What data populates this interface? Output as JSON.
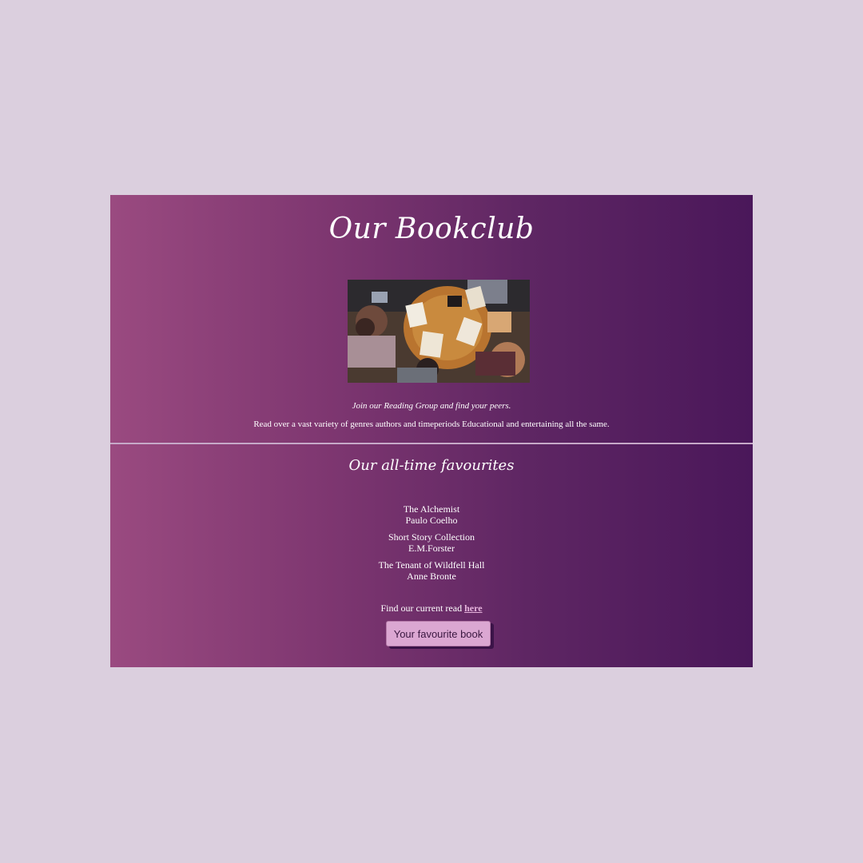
{
  "header": {
    "title": "Our Bookclub"
  },
  "hero": {
    "alt": "People reading books around a table"
  },
  "intro": {
    "tagline": "Join our Reading Group and find your peers.",
    "description": "Read over a vast variety of genres authors and timeperiods Educational and entertaining all the same."
  },
  "favourites": {
    "heading": "Our all-time favourites",
    "books": [
      {
        "title": "The Alchemist",
        "author": "Paulo Coelho"
      },
      {
        "title": "Short Story Collection",
        "author": "E.M.Forster"
      },
      {
        "title": "The Tenant of Wildfell Hall",
        "author": "Anne Bronte"
      }
    ]
  },
  "current_read": {
    "prefix": "Find our current read",
    "link_label": "here"
  },
  "button": {
    "label": "Your favourite book"
  },
  "colors": {
    "page_background": "#dbcfde",
    "gradient_start": "#9a4a80",
    "gradient_end": "#4a175a",
    "link": "#e5b3dc",
    "button_background": "#dba7d2"
  }
}
